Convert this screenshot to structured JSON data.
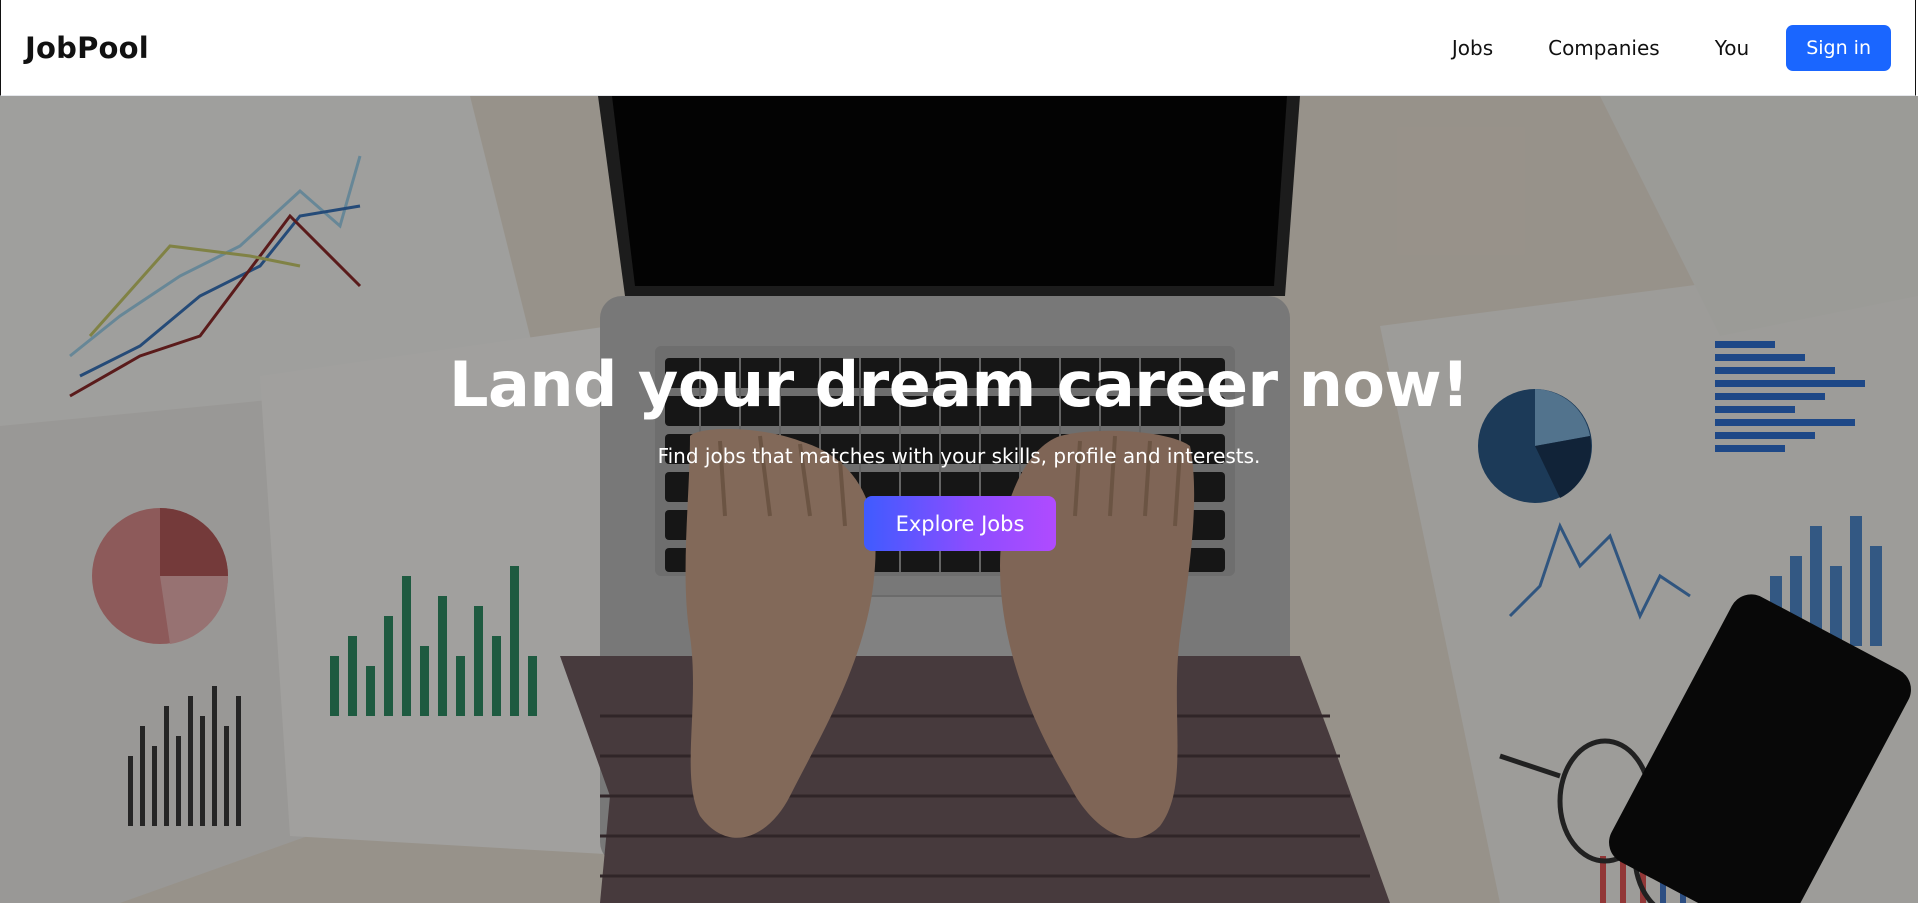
{
  "brand": {
    "name": "JobPool"
  },
  "nav": {
    "links": [
      "Jobs",
      "Companies",
      "You"
    ],
    "signin_label": "Sign in"
  },
  "hero": {
    "headline": "Land your dream career now!",
    "subline": "Find jobs that matches with your skills, profile and interests.",
    "cta_label": "Explore Jobs",
    "background": "photo-laptop-typing-desk-charts"
  },
  "colors": {
    "primary": "#1a66ff",
    "cta_gradient_start": "#3f5bff",
    "cta_gradient_end": "#b04bff"
  }
}
